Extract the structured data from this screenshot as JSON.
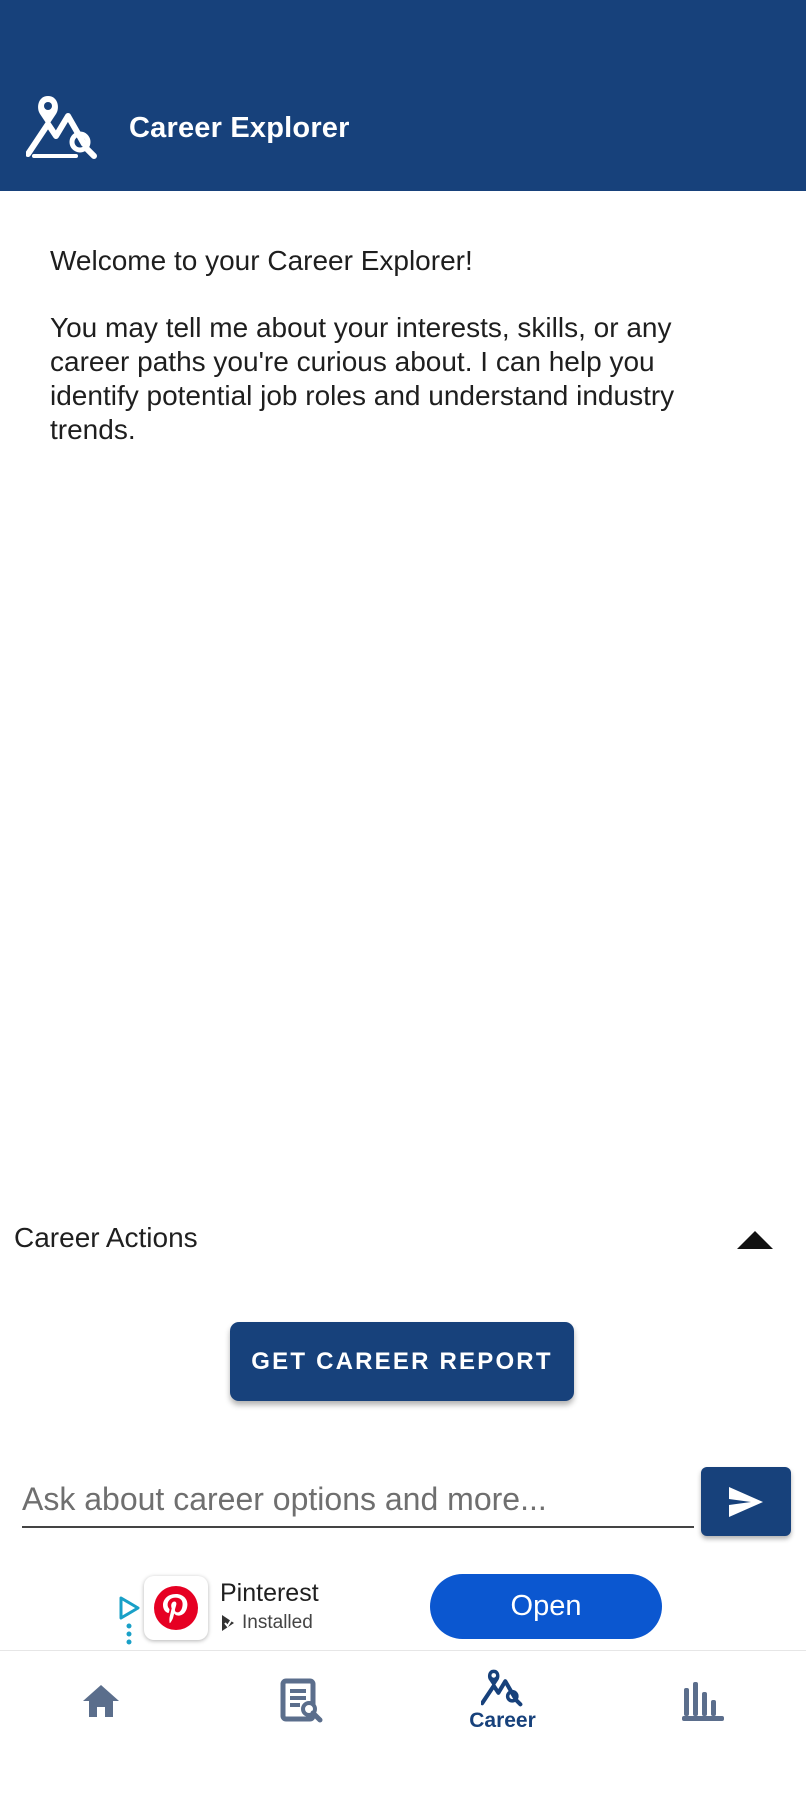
{
  "app": {
    "title": "Career Explorer"
  },
  "chat": {
    "messages": [
      "Welcome to your Career Explorer!",
      "You may tell me about your interests, skills, or any career paths you're curious about. I can help you identify potential job roles and understand industry trends."
    ]
  },
  "actions": {
    "label": "Career Actions",
    "report_button": "GET CAREER REPORT"
  },
  "input": {
    "placeholder": "Ask about career options and more..."
  },
  "ad": {
    "app_name": "Pinterest",
    "status": "Installed",
    "cta": "Open"
  },
  "nav": {
    "items": [
      {
        "label": "",
        "icon": "home-icon"
      },
      {
        "label": "",
        "icon": "article-search-icon"
      },
      {
        "label": "Career",
        "icon": "career-explorer-icon"
      },
      {
        "label": "",
        "icon": "bar-chart-icon"
      }
    ]
  },
  "colors": {
    "primary": "#17417b",
    "ad_button": "#0b57d0",
    "inactive_icon": "#5b6e8c"
  }
}
